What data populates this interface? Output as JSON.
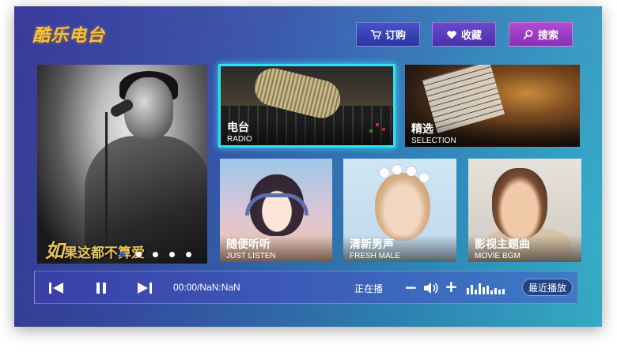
{
  "app": {
    "logo": "酷乐电台"
  },
  "header": {
    "order_label": "订购",
    "favorite_label": "收藏",
    "search_label": "搜索"
  },
  "hero": {
    "caption_first": "如",
    "caption_rest": "果这都不算爱",
    "dot_count": 5,
    "active_dot": 0
  },
  "tiles": [
    {
      "title": "电台",
      "subtitle": "RADIO"
    },
    {
      "title": "精选",
      "subtitle": "SELECTION"
    },
    {
      "title": "随便听听",
      "subtitle": "JUST LISTEN"
    },
    {
      "title": "清新男声",
      "subtitle": "FRESH MALE"
    },
    {
      "title": "影视主题曲",
      "subtitle": "MOVIE BGM"
    }
  ],
  "player": {
    "time": "00:00/NaN:NaN",
    "status": "正在播",
    "volume_down": "−",
    "volume_up": "+",
    "recent_label": "最近播放"
  },
  "colors": {
    "focus_border": "#2ee2ee",
    "logo": "#f2c24b",
    "caption": "#e9c45a"
  },
  "icons": [
    "cart-icon",
    "heart-icon",
    "search-icon",
    "previous-icon",
    "pause-icon",
    "next-icon",
    "volume-icon",
    "equalizer-icon"
  ]
}
